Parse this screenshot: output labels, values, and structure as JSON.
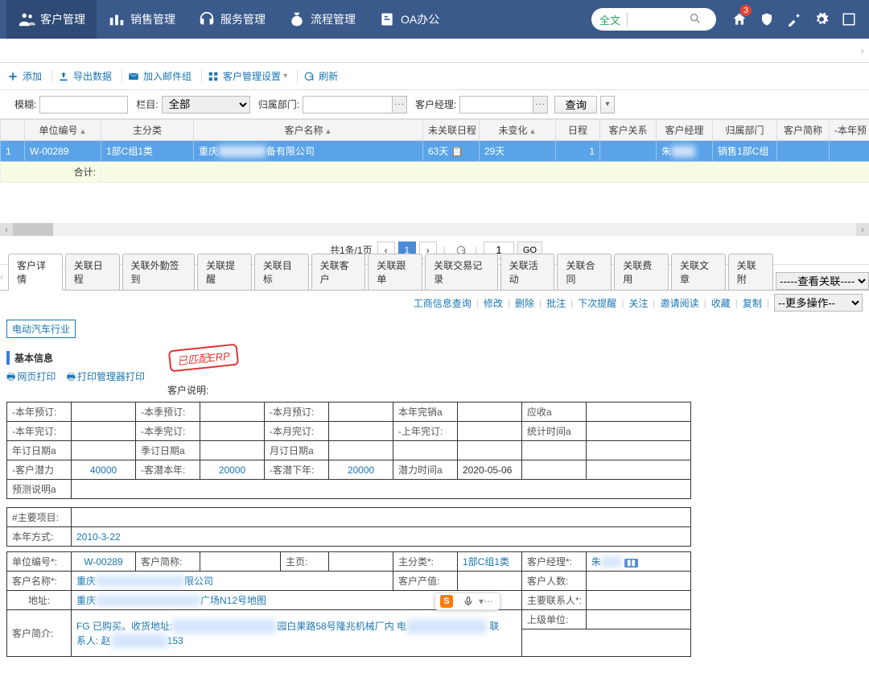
{
  "topnav": {
    "items": [
      {
        "label": "客户管理",
        "active": true
      },
      {
        "label": "销售管理"
      },
      {
        "label": "服务管理"
      },
      {
        "label": "流程管理"
      },
      {
        "label": "OA办公"
      }
    ],
    "search_label": "全文",
    "search_placeholder": "",
    "badge": "3"
  },
  "toolbar": {
    "add": "添加",
    "export": "导出数据",
    "mail": "加入邮件组",
    "settings": "客户管理设置",
    "refresh": "刷新"
  },
  "filters": {
    "fuzzy_label": "模糊:",
    "fuzzy": "",
    "column_label": "栏目:",
    "column_selected": "全部",
    "dept_label": "归属部门:",
    "dept": "",
    "manager_label": "客户经理:",
    "manager": "",
    "query": "查询"
  },
  "grid": {
    "headers": [
      "",
      "单位编号",
      "主分类",
      "客户名称",
      "未关联日程",
      "未变化",
      "日程",
      "客户关系",
      "客户经理",
      "归属部门",
      "客户简称",
      "-本年预"
    ],
    "row": {
      "idx": "1",
      "unit_no": "W-00289",
      "category": "1部C组1类",
      "name_prefix": "重庆",
      "name_suffix": "备有限公司",
      "no_schedule": "63天",
      "no_change": "29天",
      "schedule": "1",
      "relation": "",
      "manager_prefix": "朱",
      "dept": "销售1部C组",
      "short": "",
      "year": ""
    },
    "total_label": "合计:"
  },
  "pager": {
    "summary": "共1条/1页",
    "current": "1",
    "go": "GO"
  },
  "detail_tabs": [
    "客户详情",
    "关联日程",
    "关联外勤签到",
    "关联提醒",
    "关联目标",
    "关联客户",
    "关联跟单",
    "关联交易记录",
    "关联活动",
    "关联合同",
    "关联费用",
    "关联文章",
    "关联附"
  ],
  "detail_tabs_select": "-----查看关联----",
  "actions": [
    "工商信息查询",
    "修改",
    "删除",
    "批注",
    "下次提醒",
    "关注",
    "邀请阅读",
    "收藏",
    "复制"
  ],
  "actions_more": "--更多操作--",
  "industry_tag": "电动汽车行业",
  "section_basic": "基本信息",
  "print_web": "网页打印",
  "print_mgr": "打印管理器打印",
  "stamp": "已匹配ERP",
  "desc_label": "客户说明:",
  "forecast": {
    "r1": {
      "c1": "-本年预订:",
      "c2": "",
      "c3": "-本季预订:",
      "c4": "",
      "c5": "-本月预订:",
      "c6": "",
      "c7": "本年完销a",
      "c8": "",
      "c9": "应收a",
      "c10": ""
    },
    "r2": {
      "c1": "-本年完订:",
      "c2": "",
      "c3": "-本季完订:",
      "c4": "",
      "c5": "-本月完订:",
      "c6": "",
      "c7": "-上年完订:",
      "c8": "",
      "c9": "统计时间a",
      "c10": ""
    },
    "r3": {
      "c1": "年订日期a",
      "c2": "",
      "c3": "季订日期a",
      "c4": "",
      "c5": "月订日期a",
      "c6": "",
      "c7": "",
      "c8": "",
      "c9": "",
      "c10": ""
    },
    "r4": {
      "c1": "-客户潜力",
      "c2": "40000",
      "c3": "-客潜本年:",
      "c4": "20000",
      "c5": "-客潜下年:",
      "c6": "20000",
      "c7": "潜力时间a",
      "c8": "2020-05-06",
      "c9": "",
      "c10": ""
    },
    "r5": {
      "c1": "预测说明a",
      "c2": ""
    }
  },
  "info": {
    "main_proj_label": "#主要项目:",
    "year_way_label": "本年方式:",
    "year_way": "2010-3-22",
    "unit_no_label": "单位编号*:",
    "unit_no": "W-00289",
    "short_label": "客户简称:",
    "homepage_label": "主页:",
    "cat_label": "主分类*:",
    "cat": "1部C组1类",
    "manager_label": "客户经理*:",
    "manager_prefix": "朱",
    "name_label": "客户名称*:",
    "name_prefix": "重庆",
    "name_suffix": "限公司",
    "value_label": "客户产值:",
    "people_label": "客户人数:",
    "addr_label": "地址:",
    "addr_prefix": "重庆",
    "addr_suffix": "广场N12号地图",
    "contact_label": "主要联系人*:",
    "brief_label": "客户简介:",
    "brief_line1_a": "FG 已购买。收货地址:",
    "brief_line1_b": "园白果路58号隆兆机械厂内 电",
    "brief_line1_c": " 联",
    "brief_line2_a": "系人: 赵",
    "brief_line2_b": "153",
    "parent_label": "上级单位:"
  }
}
